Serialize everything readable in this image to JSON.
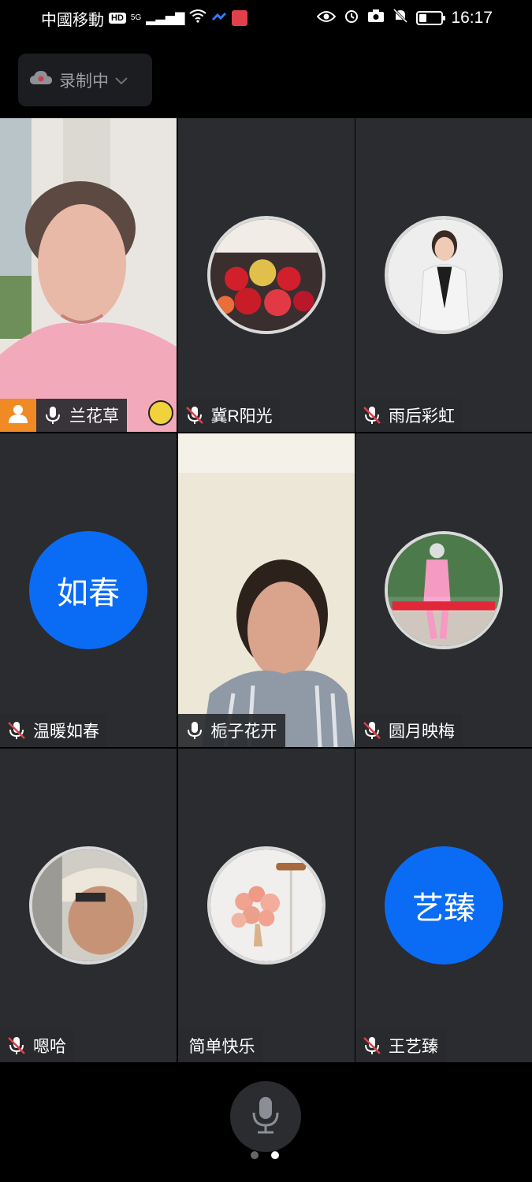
{
  "status_bar": {
    "carrier": "中國移動",
    "hd": "HD",
    "network": "5G",
    "time": "16:17",
    "battery_level": 0.35
  },
  "recording": {
    "label": "录制中"
  },
  "participants": [
    {
      "name": "兰花草",
      "mic": "on",
      "kind": "video",
      "host": true,
      "emoji": true
    },
    {
      "name": "冀R阳光",
      "mic": "muted",
      "kind": "photo-avatar"
    },
    {
      "name": "雨后彩虹",
      "mic": "muted",
      "kind": "photo-avatar"
    },
    {
      "name": "温暖如春",
      "mic": "muted",
      "kind": "text-avatar",
      "avatar_text": "如春"
    },
    {
      "name": "栀子花开",
      "mic": "on",
      "kind": "video",
      "active_speaker": true
    },
    {
      "name": "圆月映梅",
      "mic": "muted",
      "kind": "photo-avatar"
    },
    {
      "name": "嗯哈",
      "mic": "muted",
      "kind": "photo-avatar"
    },
    {
      "name": "简单快乐",
      "mic": "none",
      "kind": "photo-avatar"
    },
    {
      "name": "王艺臻",
      "mic": "muted",
      "kind": "text-avatar",
      "avatar_text": "艺臻"
    }
  ],
  "colors": {
    "tile_bg": "#2a2c30",
    "text_avatar_blue": "#0a6cf5",
    "active_border": "#2dbe5c",
    "host_orange": "#f08a24",
    "muted_red": "#e0404a"
  },
  "pager": {
    "pages": 2,
    "current": 2
  }
}
